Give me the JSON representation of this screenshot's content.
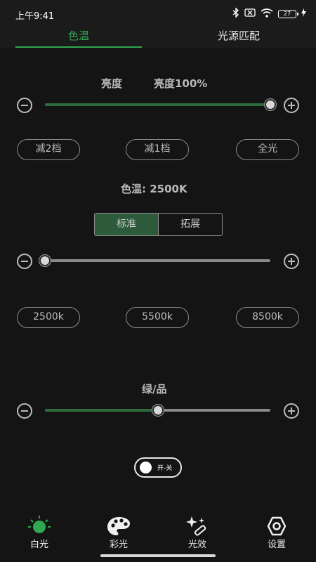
{
  "status_bar": {
    "time": "上午9:41",
    "battery": "27"
  },
  "tabs": {
    "active": "色温",
    "inactive": "光源匹配"
  },
  "brightness": {
    "title": "亮度",
    "value_label": "亮度100%",
    "level": 100
  },
  "brightness_presets": [
    "减2档",
    "减1档",
    "全光"
  ],
  "cct": {
    "title": "色温: 2500K",
    "segment_standard": "标准",
    "segment_extended": "拓展",
    "level": 0
  },
  "cct_presets": [
    "2500k",
    "5500k",
    "8500k"
  ],
  "green_magenta": {
    "title": "绿/品",
    "level": 50
  },
  "toggle": {
    "label": "开-关"
  },
  "colors": {
    "accent": "#2fa84f",
    "slider_fill": "#2d6a3c"
  },
  "nav": {
    "items": [
      {
        "label": "白光",
        "icon": "bulb-icon"
      },
      {
        "label": "彩光",
        "icon": "palette-icon"
      },
      {
        "label": "光效",
        "icon": "effects-icon"
      },
      {
        "label": "设置",
        "icon": "settings-icon"
      }
    ]
  }
}
